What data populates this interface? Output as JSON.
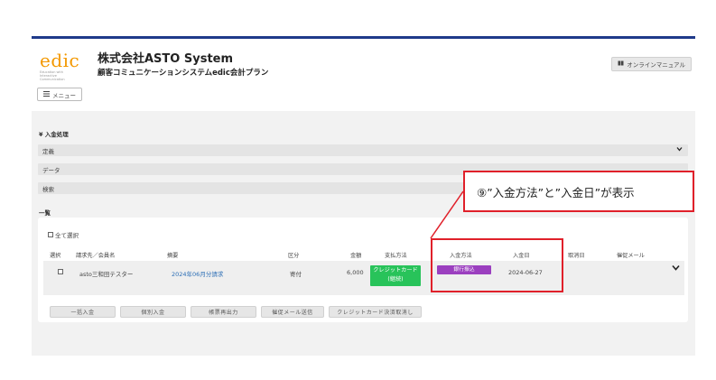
{
  "header": {
    "logo": {
      "word": "edic",
      "tagline": "Education with Interactive Communication"
    },
    "company": "株式会社ASTO System",
    "subtitle": "顧客コミュニケーションシステムedic会計プラン",
    "manual_button": "オンラインマニュアル",
    "menu_button": "メニュー"
  },
  "section": {
    "title": "¥ 入金処理",
    "filters": [
      "定義",
      "データ",
      "検索"
    ],
    "list_label": "一覧"
  },
  "table": {
    "select_all": "全て選択",
    "columns": [
      "選択",
      "請求先／会員名",
      "摘要",
      "区分",
      "金額",
      "支払方法",
      "入金方法",
      "入金日",
      "取消日",
      "催促メール"
    ],
    "rows": [
      {
        "name": "asto三和田テスター",
        "summary": "2024年06月分請求",
        "category": "寄付",
        "amount": "6,000",
        "payment_method_line1": "クレジットカード",
        "payment_method_line2": "(継続)",
        "deposit_method": "銀行振込",
        "deposit_date": "2024-06-27",
        "cancel_date": "",
        "reminder_mail": ""
      }
    ]
  },
  "actions": [
    "一括入金",
    "個別入金",
    "帳票再出力",
    "催促メール送信",
    "クレジットカード決済取消し"
  ],
  "annotation": {
    "callout": "⑨”入金方法”と”入金日”が表示"
  },
  "colors": {
    "brand_blue": "#1f3a8a",
    "logo_orange": "#f39800",
    "highlight_red": "#e0202a",
    "badge_green": "#28c35a",
    "badge_purple": "#9b3fbf",
    "link_blue": "#2a6db5"
  }
}
